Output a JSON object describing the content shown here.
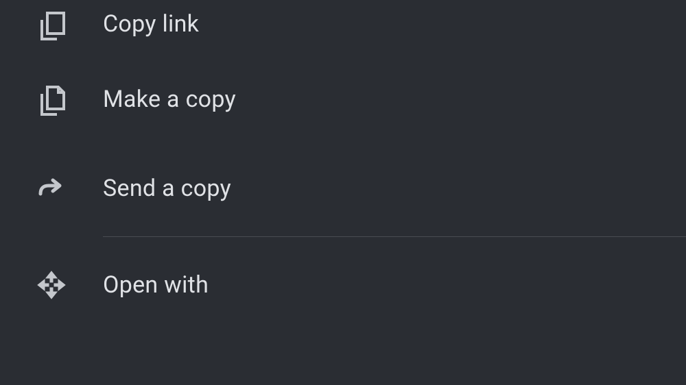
{
  "menu": {
    "items": [
      {
        "label": "Copy link"
      },
      {
        "label": "Make a copy"
      },
      {
        "label": "Send a copy"
      },
      {
        "label": "Open with"
      }
    ]
  }
}
